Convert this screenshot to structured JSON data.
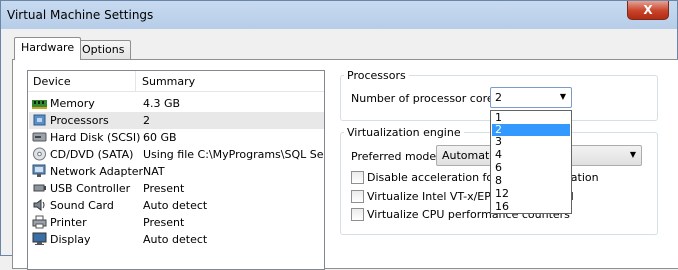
{
  "window": {
    "title": "Virtual Machine Settings",
    "close_symbol": "X"
  },
  "tabs": [
    {
      "label": "Hardware"
    },
    {
      "label": "Options"
    }
  ],
  "device_list": {
    "columns": [
      "Device",
      "Summary"
    ],
    "rows": [
      {
        "device": "Memory",
        "summary": "4.3 GB",
        "icon": "memory-icon"
      },
      {
        "device": "Processors",
        "summary": "2",
        "icon": "processor-icon"
      },
      {
        "device": "Hard Disk (SCSI)",
        "summary": "60 GB",
        "icon": "hard-disk-icon"
      },
      {
        "device": "CD/DVD (SATA)",
        "summary": "Using file C:\\MyPrograms\\SQL Ser...",
        "icon": "cd-dvd-icon"
      },
      {
        "device": "Network Adapter",
        "summary": "NAT",
        "icon": "network-adapter-icon"
      },
      {
        "device": "USB Controller",
        "summary": "Present",
        "icon": "usb-icon"
      },
      {
        "device": "Sound Card",
        "summary": "Auto detect",
        "icon": "sound-card-icon"
      },
      {
        "device": "Printer",
        "summary": "Present",
        "icon": "printer-icon"
      },
      {
        "device": "Display",
        "summary": "Auto detect",
        "icon": "display-icon"
      }
    ]
  },
  "processors": {
    "group_label": "Processors",
    "cores_label": "Number of processor cores:",
    "cores_value": "2",
    "cores_options": [
      "1",
      "2",
      "3",
      "4",
      "6",
      "8",
      "12",
      "16"
    ]
  },
  "virtualization": {
    "group_label": "Virtualization engine",
    "mode_label": "Preferred mode:",
    "mode_value": "Automatic",
    "checkboxes": [
      {
        "label": "Disable acceleration for binary translation",
        "checked": false
      },
      {
        "label": "Virtualize Intel VT-x/EPT or AMD-V/RVI",
        "checked": false
      },
      {
        "label": "Virtualize CPU performance counters",
        "checked": false
      }
    ]
  },
  "colors": {
    "selection": "#3399ff",
    "selected_row": "#e8e8e8",
    "close_button": "#c7432a"
  }
}
